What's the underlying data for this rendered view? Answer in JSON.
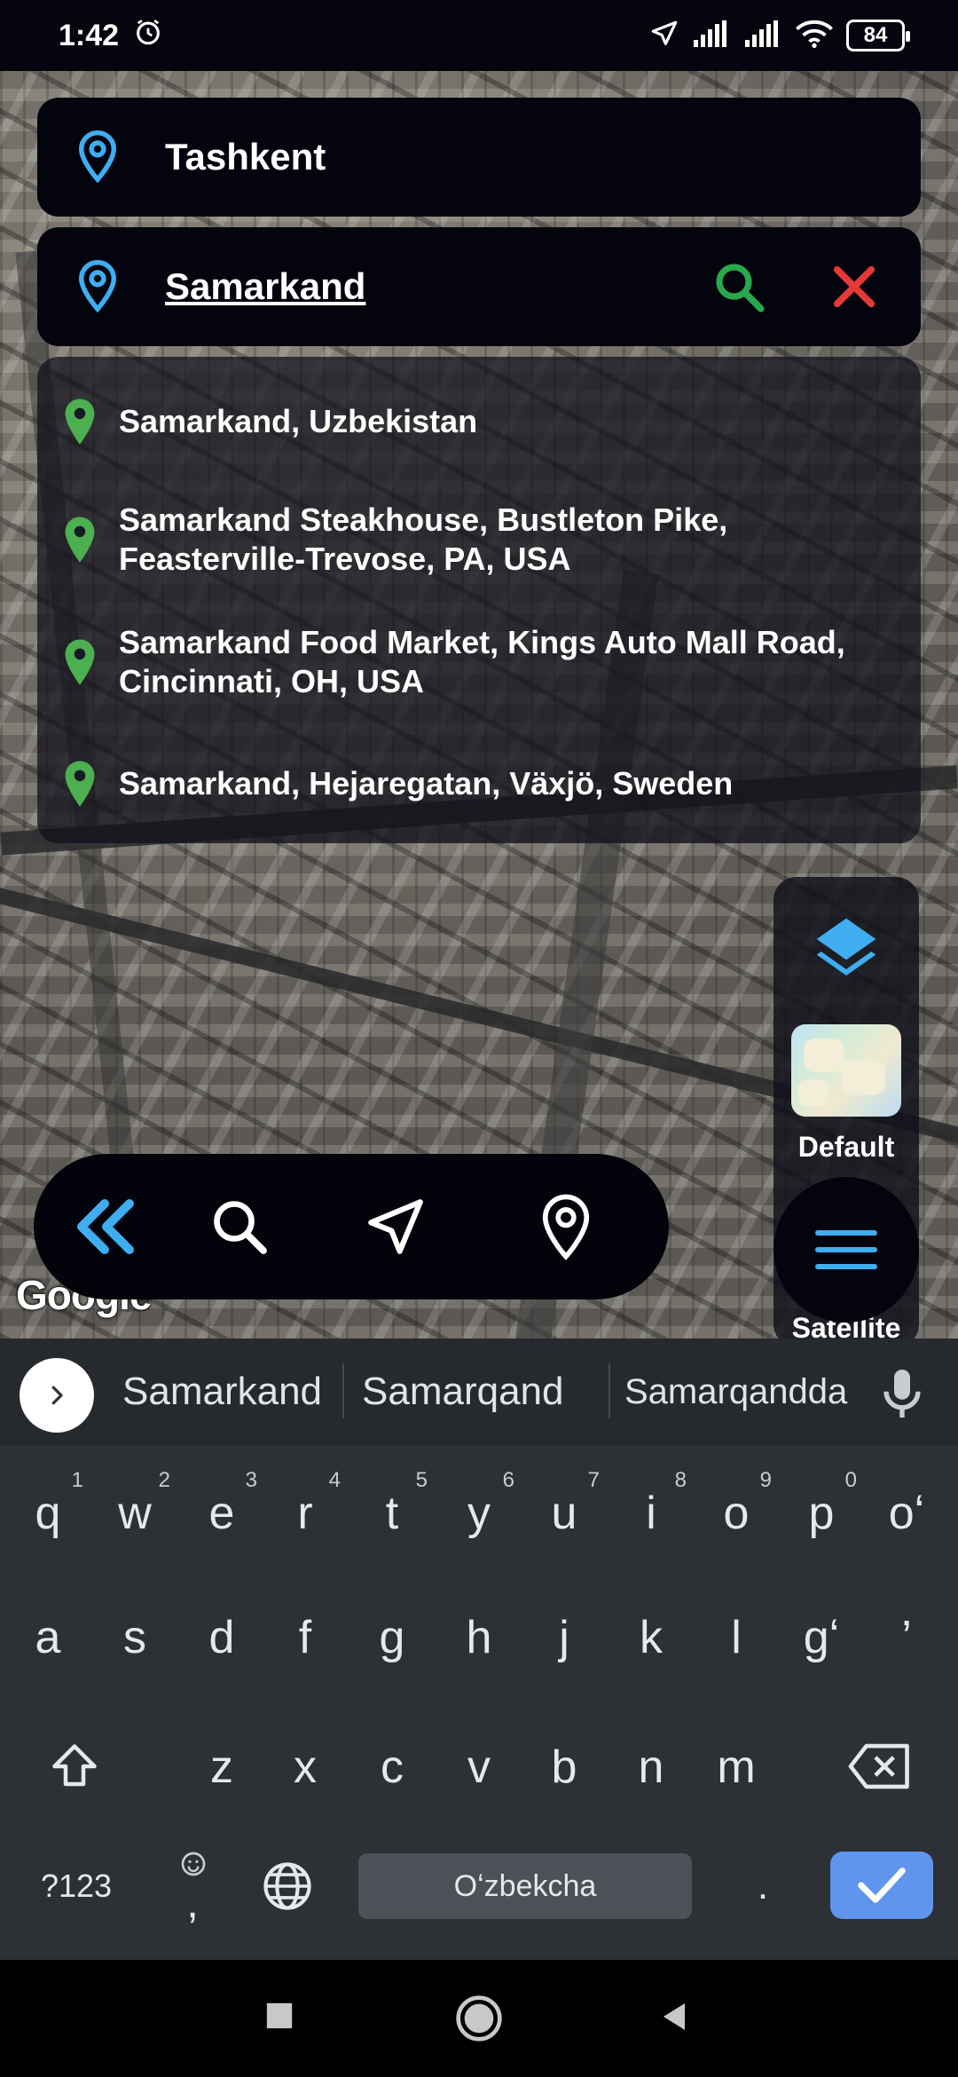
{
  "status_bar": {
    "time": "1:42",
    "battery": "84"
  },
  "route": {
    "from": "Tashkent",
    "to": "Samarkand"
  },
  "suggestions": [
    {
      "text": "Samarkand, Uzbekistan"
    },
    {
      "text": "Samarkand Steakhouse, Bustleton Pike, Feasterville-Trevose, PA, USA"
    },
    {
      "text": "Samarkand Food Market, Kings Auto Mall Road, Cincinnati, OH, USA"
    },
    {
      "text": "Samarkand, Hejaregatan, Växjö, Sweden"
    }
  ],
  "map_layers": {
    "default_label": "Default",
    "satellite_label": "Satellite"
  },
  "map_attribution": "Google",
  "colors": {
    "accent_blue": "#3eaef0",
    "search_green": "#29a84d",
    "clear_red": "#e53935",
    "pin_green": "#4caf50",
    "enter_blue": "#5f95ec"
  },
  "action_bar": {
    "icons": [
      "double-chevron-left-icon",
      "search-icon",
      "navigation-arrow-icon",
      "location-pin-icon"
    ]
  },
  "keyboard": {
    "suggestions": [
      "Samarkand",
      "Samarqand",
      "Samarqandda"
    ],
    "row1": [
      {
        "key": "q",
        "sup": "1"
      },
      {
        "key": "w",
        "sup": "2"
      },
      {
        "key": "e",
        "sup": "3"
      },
      {
        "key": "r",
        "sup": "4"
      },
      {
        "key": "t",
        "sup": "5"
      },
      {
        "key": "y",
        "sup": "6"
      },
      {
        "key": "u",
        "sup": "7"
      },
      {
        "key": "i",
        "sup": "8"
      },
      {
        "key": "o",
        "sup": "9"
      },
      {
        "key": "p",
        "sup": "0"
      },
      {
        "key": "oʻ",
        "sup": ""
      }
    ],
    "row2": [
      "a",
      "s",
      "d",
      "f",
      "g",
      "h",
      "j",
      "k",
      "l",
      "gʻ",
      "’"
    ],
    "row3": [
      "z",
      "x",
      "c",
      "v",
      "b",
      "n",
      "m"
    ],
    "symbols_label": "?123",
    "comma_label": ",",
    "space_label": "Oʻzbekcha",
    "period_label": "."
  }
}
